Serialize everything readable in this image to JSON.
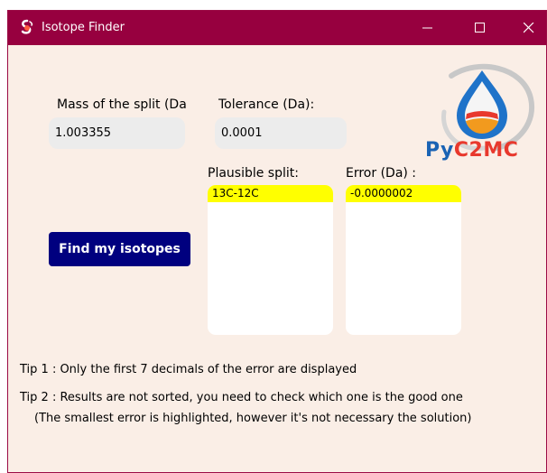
{
  "window": {
    "title": "Isotope Finder",
    "colors": {
      "titlebar": "#97003f",
      "background": "#faeee6",
      "button": "#00007f",
      "highlight": "#ffff00"
    }
  },
  "titlebar": {
    "icons": [
      "app-logo-icon",
      "minimize-icon",
      "maximize-icon",
      "close-icon"
    ]
  },
  "form": {
    "mass_label": "Mass of the split (Da",
    "mass_value": "1.003355",
    "tolerance_label": "Tolerance (Da):",
    "tolerance_value": "0.0001",
    "split_label": "Plausible split:",
    "error_label": "Error (Da) :",
    "find_button": "Find my isotopes"
  },
  "results": {
    "splits": [
      "13C-12C"
    ],
    "errors": [
      "-0.0000002"
    ]
  },
  "logo": {
    "text_py": "Py",
    "text_c2mc": "C2MC"
  },
  "tips": {
    "tip1": "Tip 1 : Only the first 7 decimals of the error are displayed",
    "tip2": "Tip 2 : Results are not sorted, you need to check which one is the good one",
    "tip2b": "(The smallest error is highlighted, however it's not necessary the solution)"
  }
}
